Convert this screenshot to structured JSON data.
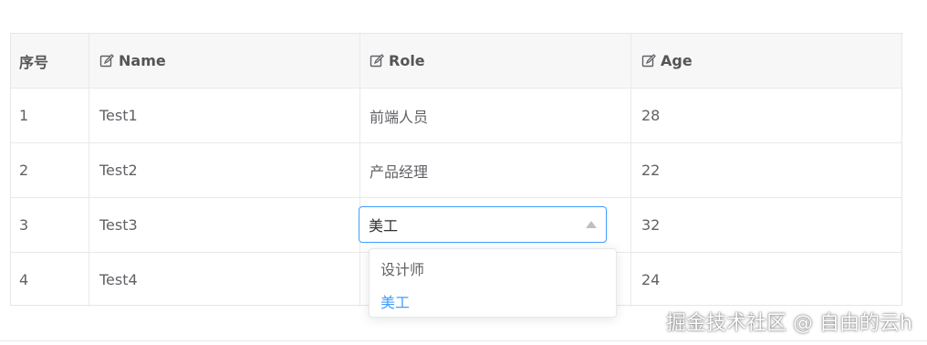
{
  "table": {
    "headers": [
      {
        "label": "序号",
        "icon": ""
      },
      {
        "label": "Name",
        "icon": "edit-icon"
      },
      {
        "label": "Role",
        "icon": "edit-icon"
      },
      {
        "label": "Age",
        "icon": "edit-icon"
      }
    ],
    "rows": [
      {
        "index": "1",
        "name": "Test1",
        "role": "前端人员",
        "age": "28"
      },
      {
        "index": "2",
        "name": "Test2",
        "role": "产品经理",
        "age": "22"
      },
      {
        "index": "3",
        "name": "Test3",
        "role": "美工",
        "age": "32"
      },
      {
        "index": "4",
        "name": "Test4",
        "role": "",
        "age": "24"
      }
    ]
  },
  "role_select": {
    "value": "美工",
    "options": [
      {
        "label": "设计师",
        "selected": false
      },
      {
        "label": "美工",
        "selected": true
      }
    ]
  },
  "watermark": "掘金技术社区 @ 自由的云h",
  "colors": {
    "accent": "#409eff",
    "header_bg": "#f7f7f7",
    "border": "#e6e6e6",
    "text": "#606266"
  }
}
